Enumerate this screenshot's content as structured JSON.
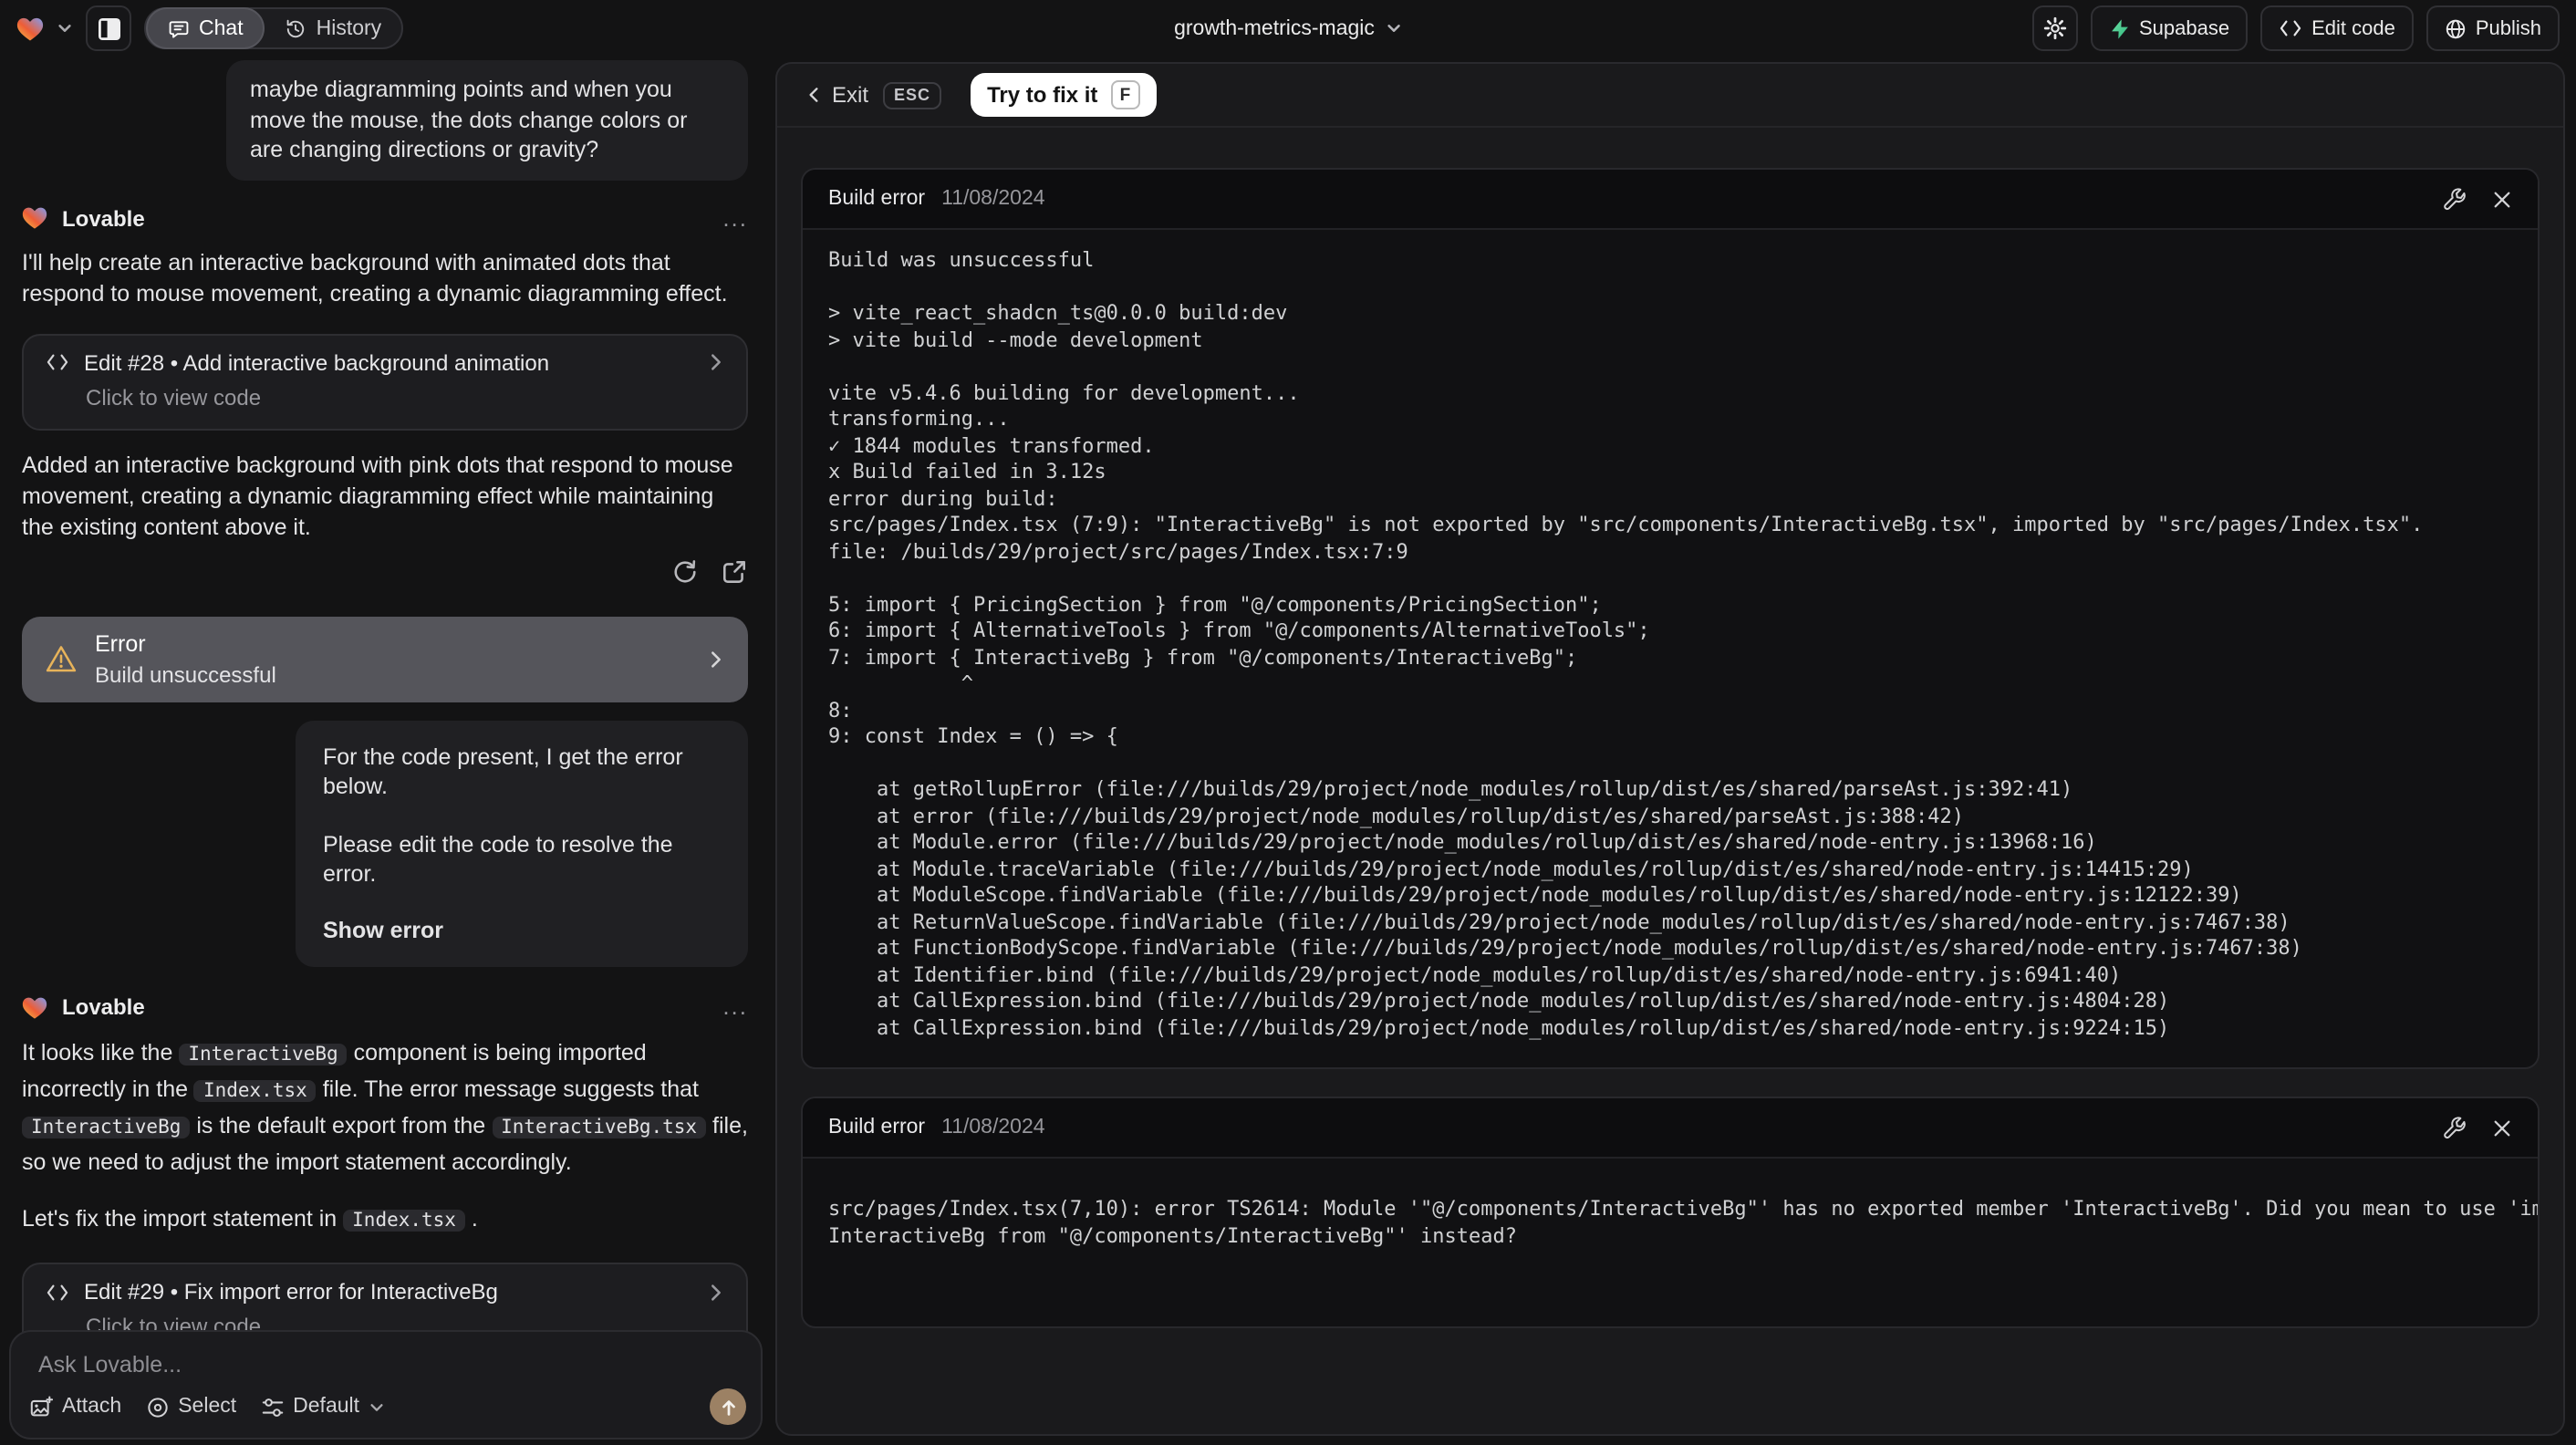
{
  "header": {
    "logo_alt": "Lovable",
    "tab_chat": "Chat",
    "tab_history": "History",
    "project_name": "growth-metrics-magic",
    "supabase_label": "Supabase",
    "edit_code_label": "Edit code",
    "publish_label": "Publish"
  },
  "chat": {
    "assistant_name": "Lovable",
    "more_menu": "...",
    "user_message_1": "maybe diagramming points and when you move the mouse, the dots change colors or are changing directions or gravity?",
    "assistant_intro": "I'll help create an interactive background with animated dots that respond to mouse movement, creating a dynamic diagramming effect.",
    "edit_card_28": {
      "title": "Edit #28 • Add interactive background animation",
      "subtitle": "Click to view code"
    },
    "assistant_summary": "Added an interactive background with pink dots that respond to mouse movement, creating a dynamic diagramming effect while maintaining the existing content above it.",
    "error_card": {
      "title": "Error",
      "subtitle": "Build unsuccessful"
    },
    "user_message_2": {
      "paragraph_1": "For the code present, I get the error below.",
      "paragraph_2": "Please edit the code to resolve the error.",
      "action": "Show error"
    },
    "assistant_fix_rich": [
      {
        "t": "It looks like the "
      },
      {
        "c": "InteractiveBg"
      },
      {
        "t": " component is being imported incorrectly in the "
      },
      {
        "c": "Index.tsx"
      },
      {
        "t": " file. The error message suggests that "
      },
      {
        "c": "InteractiveBg"
      },
      {
        "t": " is the default export from the "
      },
      {
        "c": "InteractiveBg.tsx"
      },
      {
        "t": " file, so we need to adjust the import statement accordingly."
      }
    ],
    "assistant_fix_line_rich": [
      {
        "t": "Let's fix the import statement in "
      },
      {
        "c": "Index.tsx"
      },
      {
        "t": " ."
      }
    ],
    "edit_card_29": {
      "title": "Edit #29 • Fix import error for InteractiveBg",
      "subtitle": "Click to view code"
    },
    "composer": {
      "placeholder": "Ask Lovable...",
      "attach_label": "Attach",
      "select_label": "Select",
      "model_label": "Default"
    }
  },
  "error_view": {
    "exit_label": "Exit",
    "esc_key": "ESC",
    "fix_label": "Try to fix it",
    "fix_key": "F",
    "card_1": {
      "title": "Build error",
      "date": "11/08/2024",
      "log": "Build was unsuccessful\n\n> vite_react_shadcn_ts@0.0.0 build:dev\n> vite build --mode development\n\nvite v5.4.6 building for development...\ntransforming...\n✓ 1844 modules transformed.\nx Build failed in 3.12s\nerror during build:\nsrc/pages/Index.tsx (7:9): \"InteractiveBg\" is not exported by \"src/components/InteractiveBg.tsx\", imported by \"src/pages/Index.tsx\".\nfile: /builds/29/project/src/pages/Index.tsx:7:9\n\n5: import { PricingSection } from \"@/components/PricingSection\";\n6: import { AlternativeTools } from \"@/components/AlternativeTools\";\n7: import { InteractiveBg } from \"@/components/InteractiveBg\";\n           ^\n8: \n9: const Index = () => {\n\n    at getRollupError (file:///builds/29/project/node_modules/rollup/dist/es/shared/parseAst.js:392:41)\n    at error (file:///builds/29/project/node_modules/rollup/dist/es/shared/parseAst.js:388:42)\n    at Module.error (file:///builds/29/project/node_modules/rollup/dist/es/shared/node-entry.js:13968:16)\n    at Module.traceVariable (file:///builds/29/project/node_modules/rollup/dist/es/shared/node-entry.js:14415:29)\n    at ModuleScope.findVariable (file:///builds/29/project/node_modules/rollup/dist/es/shared/node-entry.js:12122:39)\n    at ReturnValueScope.findVariable (file:///builds/29/project/node_modules/rollup/dist/es/shared/node-entry.js:7467:38)\n    at FunctionBodyScope.findVariable (file:///builds/29/project/node_modules/rollup/dist/es/shared/node-entry.js:7467:38)\n    at Identifier.bind (file:///builds/29/project/node_modules/rollup/dist/es/shared/node-entry.js:6941:40)\n    at CallExpression.bind (file:///builds/29/project/node_modules/rollup/dist/es/shared/node-entry.js:4804:28)\n    at CallExpression.bind (file:///builds/29/project/node_modules/rollup/dist/es/shared/node-entry.js:9224:15)"
    },
    "card_2": {
      "title": "Build error",
      "date": "11/08/2024",
      "log": "src/pages/Index.tsx(7,10): error TS2614: Module '\"@/components/InteractiveBg\"' has no exported member 'InteractiveBg'. Did you mean to use 'import\nInteractiveBg from \"@/components/InteractiveBg\"' instead?"
    }
  },
  "colors": {
    "warning_amber": "#e7b35a",
    "supabase_green": "#3ecf8e",
    "fix_button_bg": "#ffffff",
    "error_card_bg": "#55555b"
  }
}
